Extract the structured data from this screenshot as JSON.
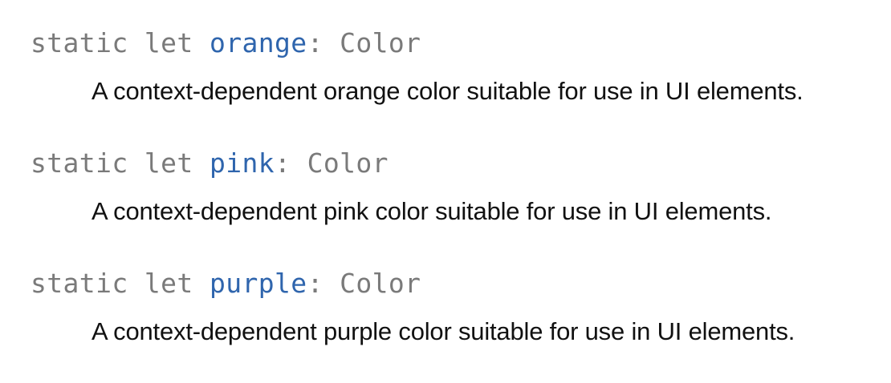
{
  "symbols": [
    {
      "keywords": "static let ",
      "name": "orange",
      "separator": ": ",
      "type": "Color",
      "abstract": "A context-dependent orange color suitable for use in UI elements."
    },
    {
      "keywords": "static let ",
      "name": "pink",
      "separator": ": ",
      "type": "Color",
      "abstract": "A context-dependent pink color suitable for use in UI elements."
    },
    {
      "keywords": "static let ",
      "name": "purple",
      "separator": ": ",
      "type": "Color",
      "abstract": "A context-dependent purple color suitable for use in UI elements."
    }
  ],
  "colors": {
    "keyword": "#7a7a7a",
    "symbol_link": "#2f65ad",
    "abstract_text": "#111111",
    "background": "#ffffff"
  }
}
